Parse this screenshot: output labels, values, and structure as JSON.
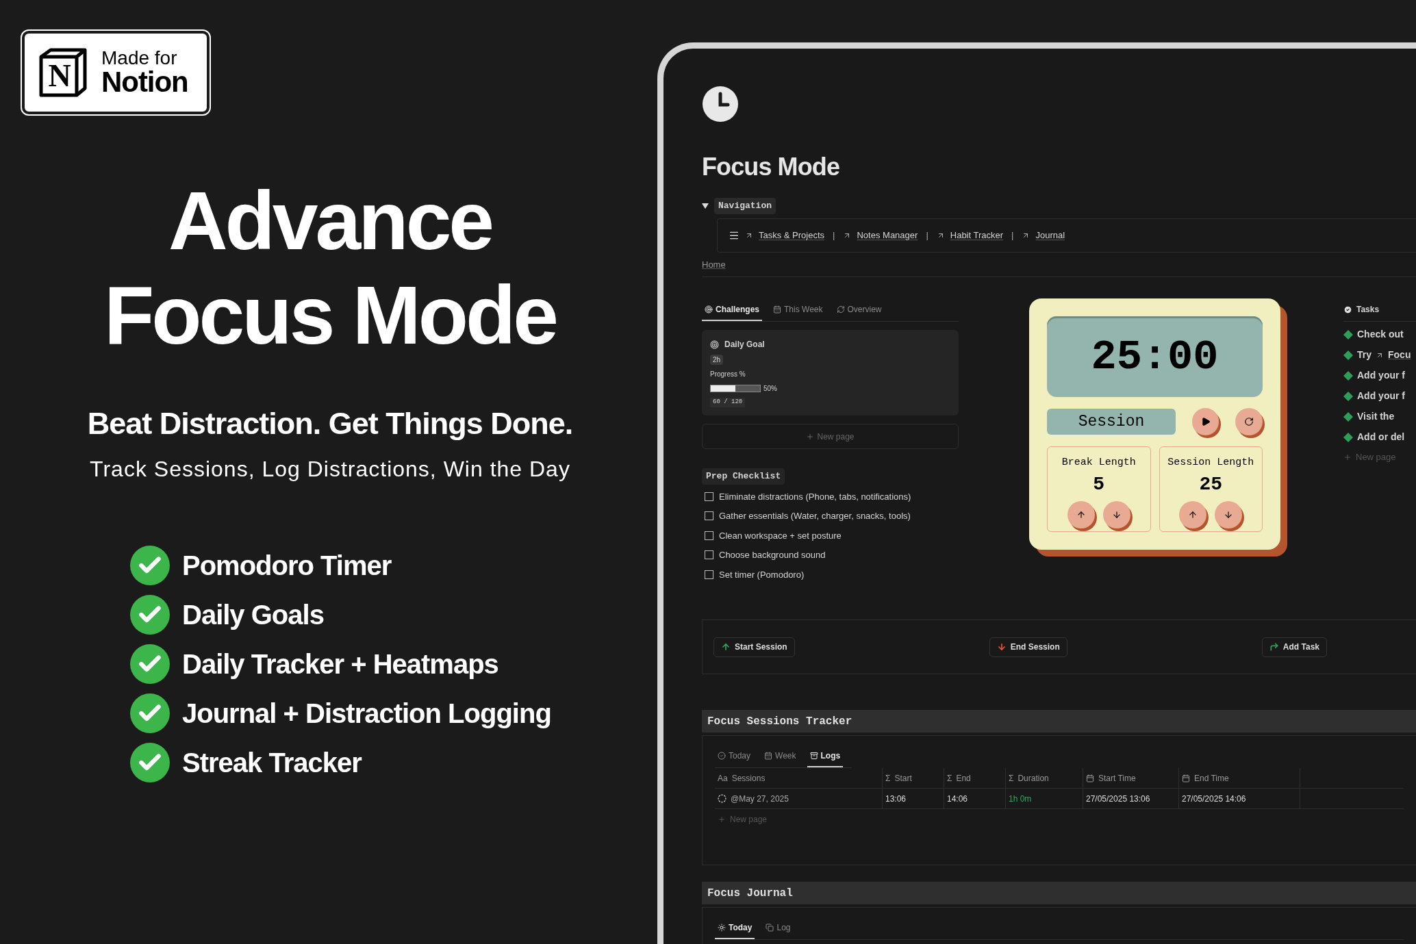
{
  "badge": {
    "logo_letter": "N",
    "line1": "Made for",
    "line2": "Notion"
  },
  "hero": {
    "title_lines": [
      "Advance",
      "Focus Mode"
    ],
    "tagline": "Beat Distraction. Get Things Done.",
    "subtitle": "Track Sessions, Log Distractions, Win the Day",
    "features": [
      "Pomodoro Timer",
      "Daily Goals",
      "Daily Tracker + Heatmaps",
      "Journal + Distraction Logging",
      "Streak Tracker"
    ]
  },
  "page": {
    "title": "Focus Mode",
    "navigation": {
      "label": "Navigation",
      "expanded": true,
      "links": [
        "Tasks & Projects",
        "Notes Manager",
        "Habit Tracker",
        "Journal"
      ],
      "separator": "|"
    },
    "breadcrumb": "Home",
    "challenges": {
      "tabs": [
        {
          "label": "Challenges",
          "kind": "target",
          "selected": true
        },
        {
          "label": "This Week",
          "kind": "calendar",
          "selected": false
        },
        {
          "label": "Overview",
          "kind": "loop",
          "selected": false
        }
      ],
      "card": {
        "title": "Daily Goal",
        "tag": "2h",
        "progress_label": "Progress %",
        "level": 0.5,
        "percent": "50%",
        "count": "60 / 120"
      },
      "new_page": "New page"
    },
    "checklist": {
      "title": "Prep Checklist",
      "items": [
        {
          "label": "Eliminate distractions (Phone, tabs, notifications)",
          "checked": false
        },
        {
          "label": "Gather essentials (Water, charger, snacks, tools)",
          "checked": false
        },
        {
          "label": "Clean workspace + set posture",
          "checked": false
        },
        {
          "label": "Choose background sound",
          "checked": false
        },
        {
          "label": "Set timer (Pomodoro)",
          "checked": false
        }
      ]
    },
    "timer": {
      "time": "25:00",
      "mode": "Session",
      "lengths": [
        {
          "label": "Break Length",
          "value": "5"
        },
        {
          "label": "Session Length",
          "value": "25"
        }
      ]
    },
    "tasks": {
      "title": "Tasks",
      "items": [
        {
          "text": "Check out"
        },
        {
          "text": "Try",
          "link": "Focu"
        },
        {
          "text": "Add your f"
        },
        {
          "text": "Add your f"
        },
        {
          "text": "Visit the"
        },
        {
          "text": "Add or del"
        }
      ],
      "new_page": "New page"
    },
    "actions": [
      {
        "label": "Start Session",
        "kind": "start"
      },
      {
        "label": "End Session",
        "kind": "end"
      },
      {
        "label": "Add Task",
        "kind": "add"
      }
    ],
    "tracker": {
      "title": "Focus Sessions Tracker",
      "tabs": [
        {
          "label": "Today",
          "kind": "check",
          "selected": false
        },
        {
          "label": "Week",
          "kind": "calendar",
          "selected": false
        },
        {
          "label": "Logs",
          "kind": "archive",
          "selected": true
        }
      ],
      "columns": [
        {
          "label": "Sessions",
          "kind": "title",
          "symbol": "Aa"
        },
        {
          "label": "Start",
          "kind": "formula",
          "symbol": "Σ"
        },
        {
          "label": "End",
          "kind": "formula",
          "symbol": "Σ"
        },
        {
          "label": "Duration",
          "kind": "duration",
          "symbol": "Σ"
        },
        {
          "label": "Start Time",
          "kind": "date"
        },
        {
          "label": "End Time",
          "kind": "date"
        }
      ],
      "rows": [
        {
          "cells": [
            "@May 27, 2025",
            "13:06",
            "14:06",
            "1h 0m",
            "27/05/2025 13:06",
            "27/05/2025 14:06"
          ]
        }
      ],
      "new_page": "New page"
    },
    "journal": {
      "title": "Focus Journal",
      "tabs": [
        {
          "label": "Today",
          "kind": "sun",
          "selected": true
        },
        {
          "label": "Log",
          "kind": "pages",
          "selected": false
        }
      ]
    }
  }
}
